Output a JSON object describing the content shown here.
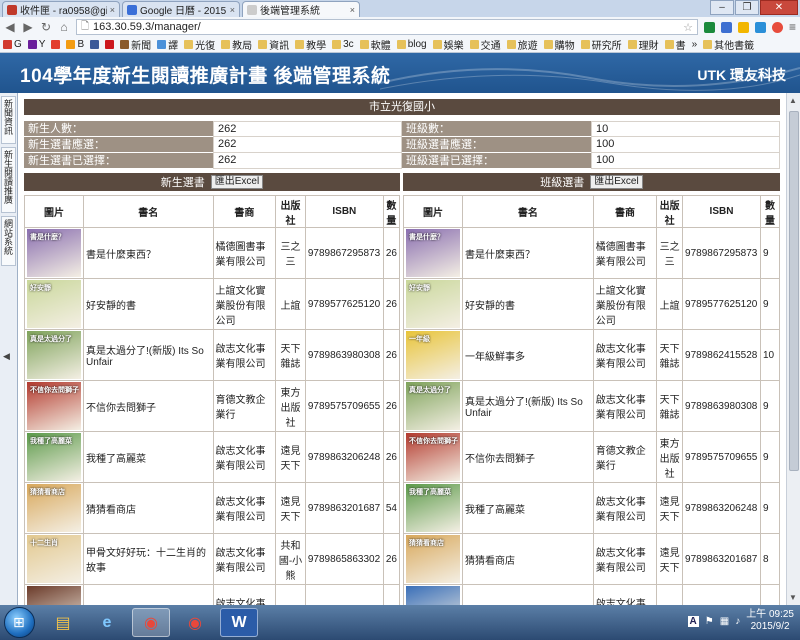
{
  "browser": {
    "tabs": [
      {
        "title": "收件匣 - ra0958@gi",
        "favicon_color": "#c0392b"
      },
      {
        "title": "Google 日曆 - 2015",
        "favicon_color": "#3a6fd8"
      },
      {
        "title": "後端管理系統",
        "favicon_color": "#cccccc"
      }
    ],
    "close_glyph": "×",
    "url": "163.30.59.3/manager/",
    "bookmarks": [
      "G",
      "Y",
      "",
      "B",
      "",
      "",
      "新聞",
      "譯",
      "光復",
      "教局",
      "資訊",
      "教學",
      "3c",
      "軟體",
      "blog",
      "娛樂",
      "交通",
      "旅遊",
      "購物",
      "研究所",
      "理財",
      "書"
    ],
    "other_bookmarks": "其他書籤",
    "more": "»"
  },
  "app": {
    "title": "104學年度新生閱讀推廣計畫 後端管理系統",
    "brand": "UTK 環友科技"
  },
  "sidemenu": {
    "items": [
      "新聞資訊",
      "新生閱讀推廣",
      "網站系統"
    ]
  },
  "school": "市立光復國小",
  "stats": {
    "rows": [
      {
        "l1": "新生人數：",
        "v1": "262",
        "l2": "班級數：",
        "v2": "10"
      },
      {
        "l1": "新生選書應選：",
        "v1": "262",
        "l2": "班級選書應選：",
        "v2": "100"
      },
      {
        "l1": "新生選書已選擇：",
        "v1": "262",
        "l2": "班級選書已選擇：",
        "v2": "100"
      }
    ]
  },
  "left_section": {
    "title": "新生選書",
    "export": "匯出Excel"
  },
  "right_section": {
    "title": "班級選書",
    "export": "匯出Excel"
  },
  "columns": [
    "圖片",
    "書名",
    "書商",
    "出版社",
    "ISBN",
    "數量"
  ],
  "left_rows": [
    {
      "cover": "#8a6fb0",
      "ctitle": "書是什麼？",
      "name": "書是什麼東西？",
      "vendor": "橘德圖書事業有限公司",
      "pub": "三之三",
      "isbn": "9789867295873",
      "qty": "26"
    },
    {
      "cover": "#c9d79a",
      "ctitle": "好安靜",
      "name": "好安靜的書",
      "vendor": "上誼文化實業股份有限公司",
      "pub": "上誼",
      "isbn": "9789577625120",
      "qty": "26"
    },
    {
      "cover": "#7fa35b",
      "ctitle": "真是太過分了",
      "name": "真是太過分了!(新版) Its So Unfair",
      "vendor": "啟志文化事業有限公司",
      "pub": "天下雜誌",
      "isbn": "9789863980308",
      "qty": "26"
    },
    {
      "cover": "#b33a2e",
      "ctitle": "不信你去問獅子",
      "name": "不信你去問獅子",
      "vendor": "育德文教企業行",
      "pub": "東方出版社",
      "isbn": "9789575709655",
      "qty": "26"
    },
    {
      "cover": "#5c9a4a",
      "ctitle": "我種了高麗菜",
      "name": "我種了高麗菜",
      "vendor": "啟志文化事業有限公司",
      "pub": "遠見天下",
      "isbn": "9789863206248",
      "qty": "26"
    },
    {
      "cover": "#d8a85c",
      "ctitle": "猜猜看商店",
      "name": "猜猜看商店",
      "vendor": "啟志文化事業有限公司",
      "pub": "遠見天下",
      "isbn": "9789863201687",
      "qty": "54"
    },
    {
      "cover": "#e2c88f",
      "ctitle": "十二生肖",
      "name": "甲骨文好好玩：十二生肖的故事",
      "vendor": "啟志文化事業有限公司",
      "pub": "共和國-小熊",
      "isbn": "9789865863302",
      "qty": "26"
    },
    {
      "cover": "#6b3b2a",
      "ctitle": "",
      "name": "不會寫字的獅子[histoire du",
      "vendor": "啟志文化事業",
      "pub": "米奇",
      "isbn": "",
      "qty": ""
    }
  ],
  "right_rows": [
    {
      "cover": "#8a6fb0",
      "ctitle": "書是什麼？",
      "name": "書是什麼東西？",
      "vendor": "橘德圖書事業有限公司",
      "pub": "三之三",
      "isbn": "9789867295873",
      "qty": "9"
    },
    {
      "cover": "#c9d79a",
      "ctitle": "好安靜",
      "name": "好安靜的書",
      "vendor": "上誼文化實業股份有限公司",
      "pub": "上誼",
      "isbn": "9789577625120",
      "qty": "9"
    },
    {
      "cover": "#e8c43a",
      "ctitle": "一年級",
      "name": "一年級鮮事多",
      "vendor": "啟志文化事業有限公司",
      "pub": "天下雜誌",
      "isbn": "9789862415528",
      "qty": "10"
    },
    {
      "cover": "#7fa35b",
      "ctitle": "真是太過分了",
      "name": "真是太過分了!(新版) Its So Unfair",
      "vendor": "啟志文化事業有限公司",
      "pub": "天下雜誌",
      "isbn": "9789863980308",
      "qty": "9"
    },
    {
      "cover": "#b33a2e",
      "ctitle": "不信你去問獅子",
      "name": "不信你去問獅子",
      "vendor": "育德文教企業行",
      "pub": "東方出版社",
      "isbn": "9789575709655",
      "qty": "9"
    },
    {
      "cover": "#5c9a4a",
      "ctitle": "我種了高麗菜",
      "name": "我種了高麗菜",
      "vendor": "啟志文化事業有限公司",
      "pub": "遠見天下",
      "isbn": "9789863206248",
      "qty": "9"
    },
    {
      "cover": "#d8a85c",
      "ctitle": "猜猜看商店",
      "name": "猜猜看商店",
      "vendor": "啟志文化事業有限公司",
      "pub": "遠見天下",
      "isbn": "9789863201687",
      "qty": "8"
    },
    {
      "cover": "#3a6fb8",
      "ctitle": "",
      "name": "",
      "vendor": "啟志文化事業",
      "pub": "",
      "isbn": "",
      "qty": ""
    }
  ],
  "taskbar": {
    "clock_time": "上午 09:25",
    "clock_date": "2015/9/2",
    "ime": "A"
  }
}
